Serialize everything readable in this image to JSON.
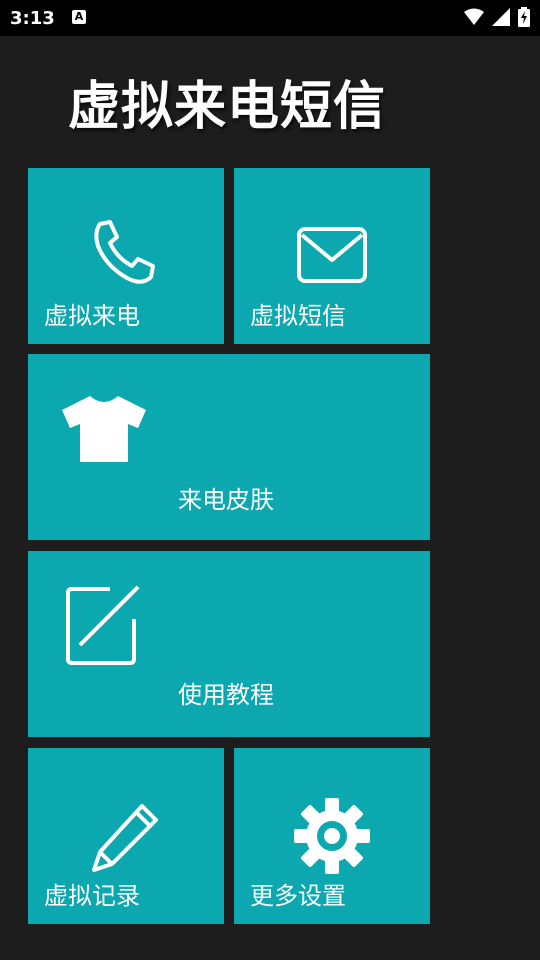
{
  "status_bar": {
    "time": "3:13",
    "notification_glyph": "A",
    "icons": [
      "wifi-icon",
      "signal-icon",
      "battery-charging-icon"
    ]
  },
  "app": {
    "title": "虚拟来电短信"
  },
  "tiles": {
    "fake_call": {
      "label": "虚拟来电",
      "icon": "phone-icon"
    },
    "fake_sms": {
      "label": "虚拟短信",
      "icon": "envelope-icon"
    },
    "call_skin": {
      "label": "来电皮肤",
      "icon": "tshirt-icon"
    },
    "tutorial": {
      "label": "使用教程",
      "icon": "edit-icon"
    },
    "records": {
      "label": "虚拟记录",
      "icon": "pencil-icon"
    },
    "settings": {
      "label": "更多设置",
      "icon": "gear-icon"
    }
  },
  "colors": {
    "background": "#1d1d1d",
    "tile": "#0ba8b0",
    "status_bar": "#000000"
  }
}
